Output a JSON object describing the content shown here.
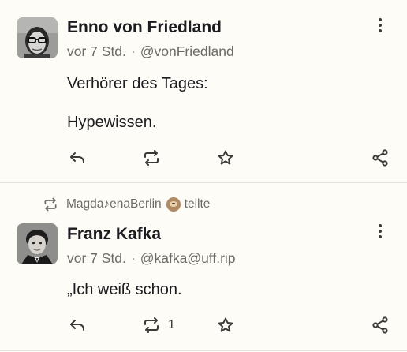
{
  "posts": [
    {
      "author": "Enno von Friedland",
      "time": "vor 7 Std.",
      "handle": "@vonFriedland",
      "paragraphs": [
        "Verhörer des Tages:",
        "Hypewissen."
      ],
      "boost_count": ""
    },
    {
      "boosted_by": "Magda♪enaBerlin",
      "boosted_label": "teilte",
      "author": "Franz Kafka",
      "time": "vor 7 Std.",
      "handle": "@kafka@uff.rip",
      "paragraphs": [
        "„Ich weiß schon."
      ],
      "boost_count": "1"
    }
  ],
  "meta_separator": "·",
  "icons": {
    "reply": "reply-icon",
    "boost": "boost-icon",
    "favourite": "star-icon",
    "share": "share-icon",
    "menu": "more-vertical-icon"
  },
  "colors": {
    "background": "#fdfcf7",
    "text": "#1c1b1f",
    "muted": "#6e6b66",
    "icon": "#3b3a37"
  }
}
